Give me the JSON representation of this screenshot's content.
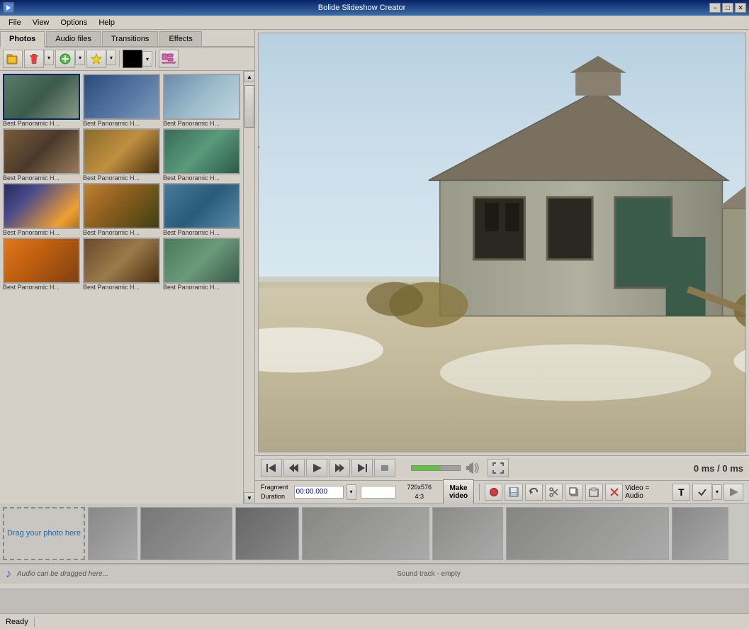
{
  "app": {
    "title": "Bolide Slideshow Creator"
  },
  "titlebar": {
    "title": "Bolide Slideshow Creator",
    "minimize": "−",
    "maximize": "□",
    "close": "✕"
  },
  "menubar": {
    "items": [
      "File",
      "View",
      "Options",
      "Help"
    ]
  },
  "tabs": {
    "items": [
      "Photos",
      "Audio files",
      "Transitions",
      "Effects"
    ],
    "active": "Photos"
  },
  "toolbar": {
    "open_label": "📂",
    "delete_label": "🗑",
    "add_label": "✚",
    "star_label": "✦",
    "color_label": "■",
    "film_label": "🎞"
  },
  "photos": {
    "items": [
      {
        "label": "Best Panoramic H...",
        "thumb_class": "thumb-1"
      },
      {
        "label": "Best Panoramic H...",
        "thumb_class": "thumb-2"
      },
      {
        "label": "Best Panoramic H...",
        "thumb_class": "thumb-3"
      },
      {
        "label": "Best Panoramic H...",
        "thumb_class": "thumb-4"
      },
      {
        "label": "Best Panoramic H...",
        "thumb_class": "thumb-5"
      },
      {
        "label": "Best Panoramic H...",
        "thumb_class": "thumb-6"
      },
      {
        "label": "Best Panoramic H...",
        "thumb_class": "thumb-7"
      },
      {
        "label": "Best Panoramic H...",
        "thumb_class": "thumb-8"
      },
      {
        "label": "Best Panoramic H...",
        "thumb_class": "thumb-9"
      },
      {
        "label": "Best Panoramic H...",
        "thumb_class": "thumb-10"
      },
      {
        "label": "Best Panoramic H...",
        "thumb_class": "thumb-11"
      },
      {
        "label": "Best Panoramic H...",
        "thumb_class": "thumb-12"
      }
    ]
  },
  "transport": {
    "rewind_to_start": "⏮",
    "prev": "⏪",
    "play": "▶",
    "next": "⏩",
    "forward_to_end": "⏭",
    "stop": "⏹",
    "time_current": "0 ms",
    "time_separator": " / ",
    "time_total": "0 ms"
  },
  "edit_bar": {
    "fragment_label": "Fragment",
    "duration_label": "Duration",
    "time_value": "00:00.000",
    "resolution": "720x576\n4:3",
    "make_video": "Make\nvideo",
    "video_audio": "Video = Audio",
    "undo": "↩",
    "cut": "✂",
    "copy": "⎘",
    "paste": "⎗",
    "delete": "✕"
  },
  "timeline": {
    "drag_photo_text": "Drag your photo here",
    "audio_icon": "♪",
    "audio_placeholder": "Audio can be dragged here...",
    "sound_track": "Sound track - empty"
  },
  "statusbar": {
    "status": "Ready"
  }
}
